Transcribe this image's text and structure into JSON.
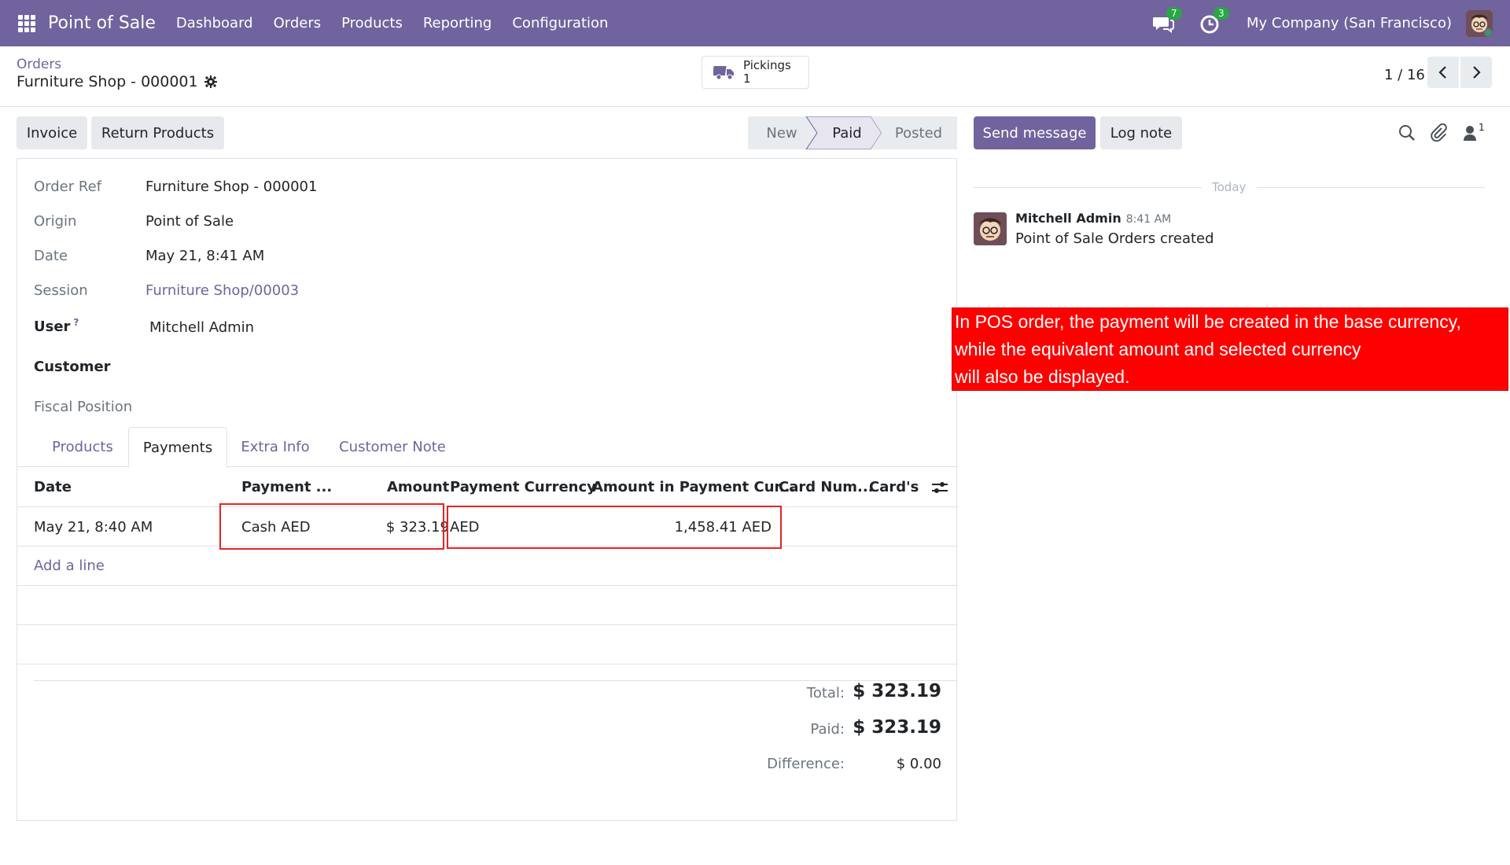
{
  "navbar": {
    "app_name": "Point of Sale",
    "menu": [
      "Dashboard",
      "Orders",
      "Products",
      "Reporting",
      "Configuration"
    ],
    "messages_count": "7",
    "activities_count": "3",
    "company": "My Company (San Francisco)"
  },
  "control_panel": {
    "breadcrumb": "Orders",
    "record_title": "Furniture Shop - 000001",
    "pickings_label": "Pickings",
    "pickings_count": "1",
    "pager": "1 / 16"
  },
  "actions": {
    "invoice": "Invoice",
    "return_products": "Return Products"
  },
  "status": {
    "steps": [
      "New",
      "Paid",
      "Posted"
    ],
    "current": "Paid"
  },
  "form": {
    "fields": [
      {
        "label": "Order Ref",
        "value": "Furniture Shop - 000001"
      },
      {
        "label": "Origin",
        "value": "Point of Sale"
      },
      {
        "label": "Date",
        "value": "May 21, 8:41 AM"
      },
      {
        "label": "Session",
        "value": "Furniture Shop/00003"
      },
      {
        "label": "User",
        "help": "?",
        "value": "Mitchell Admin"
      },
      {
        "label": "Customer",
        "value": ""
      },
      {
        "label": "Fiscal Position",
        "value": ""
      }
    ],
    "tabs": [
      "Products",
      "Payments",
      "Extra Info",
      "Customer Note"
    ],
    "active_tab": "Payments"
  },
  "payments_table": {
    "columns": [
      "Date",
      "Payment ...",
      "Amount",
      "Payment Currency",
      "Amount in Payment Cur...",
      "Card Num...",
      "Card's B"
    ],
    "rows": [
      {
        "date": "May 21, 8:40 AM",
        "payment_method": "Cash AED",
        "amount": "$ 323.19",
        "currency": "AED",
        "amount_in_currency": "1,458.41 AED",
        "card_number": "",
        "card_brand": ""
      }
    ],
    "add_line": "Add a line"
  },
  "totals": {
    "total_label": "Total:",
    "total_value": "$ 323.19",
    "paid_label": "Paid:",
    "paid_value": "$ 323.19",
    "difference_label": "Difference:",
    "difference_value": "$ 0.00"
  },
  "chatter": {
    "send_message": "Send message",
    "log_note": "Log note",
    "followers_count": "1",
    "date_separator": "Today",
    "messages": [
      {
        "author": "Mitchell Admin",
        "time": "8:41 AM",
        "body": "Point of Sale Orders created"
      }
    ]
  },
  "callout": {
    "lines": [
      "In POS order, the payment will be created in the base currency,",
      "while the equivalent amount and selected currency",
      "will also be displayed."
    ]
  },
  "colors": {
    "brand": "#71639e",
    "badge_green": "#28a745",
    "highlight_red": "#e62323",
    "callout_red": "#ff0000"
  }
}
